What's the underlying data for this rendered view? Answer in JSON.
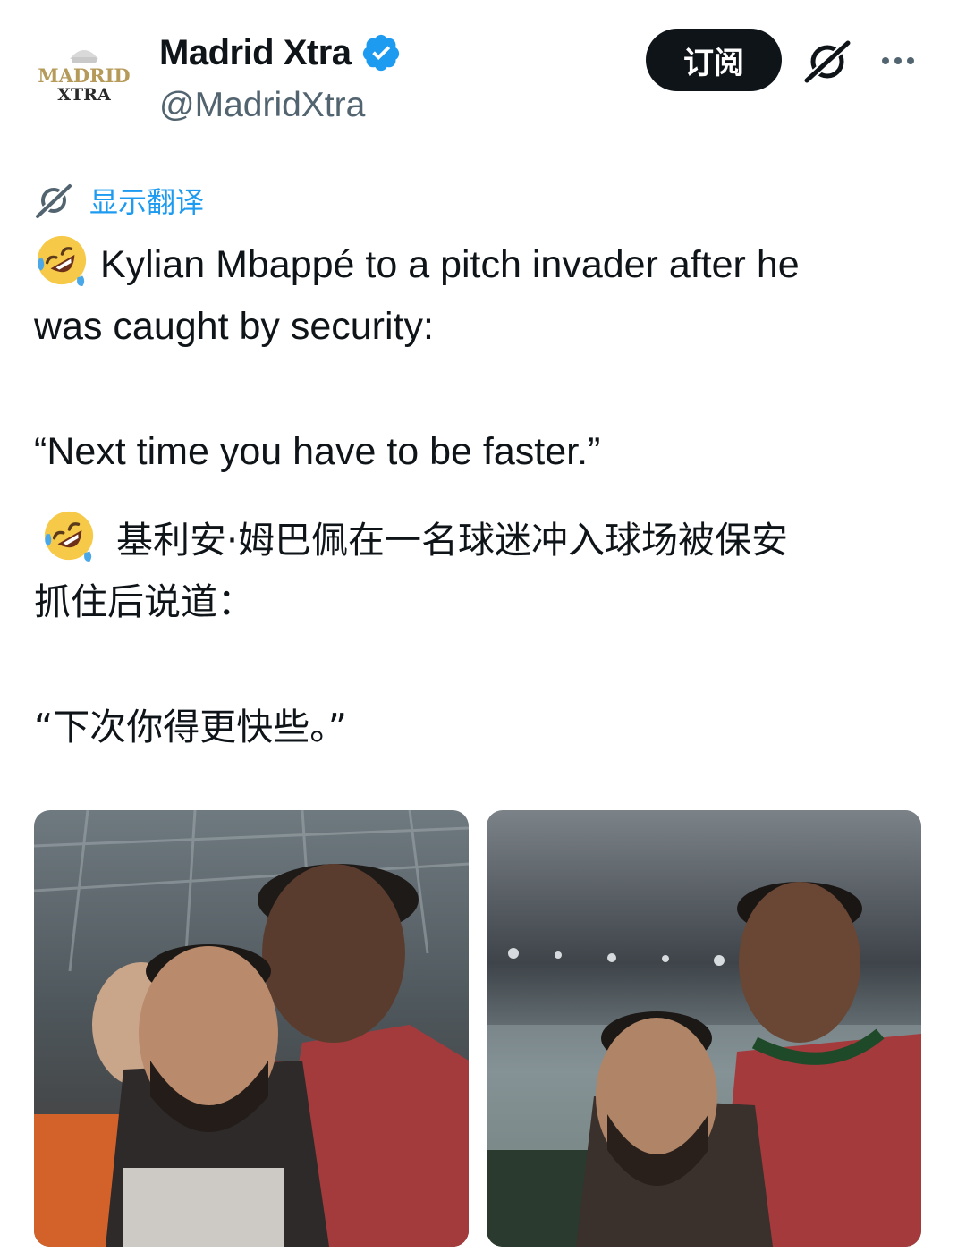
{
  "author": {
    "display_name": "Madrid Xtra",
    "handle": "@MadridXtra",
    "avatar_line1": "MADRID",
    "avatar_line2": "XTRA",
    "verified": true
  },
  "actions": {
    "subscribe_label": "订阅",
    "grok_icon": "grok-icon",
    "more_icon": "more-icon"
  },
  "translate": {
    "label": "显示翻译",
    "icon": "grok-icon"
  },
  "tweet": {
    "emoji": "rolling-on-the-floor-laughing-emoji",
    "en_line1": "Kylian Mbappé to a pitch invader after he",
    "en_line2": "was caught by security:",
    "en_quote": "“Next time you have to be faster.”",
    "zh_line1": "基利安·姆巴佩在一名球迷冲入球场被保安",
    "zh_line2": "抓住后说道：",
    "zh_quote": "“下次你得更快些。”"
  },
  "media": [
    {
      "alt": "photo-1"
    },
    {
      "alt": "photo-2"
    }
  ],
  "colors": {
    "text": "#0f1419",
    "secondary": "#536471",
    "link": "#1d9bf0",
    "verified": "#1d9bf0",
    "button_bg": "#0f1419",
    "avatar_gold": "#b59a5a",
    "avatar_dark": "#2a2a2a"
  }
}
